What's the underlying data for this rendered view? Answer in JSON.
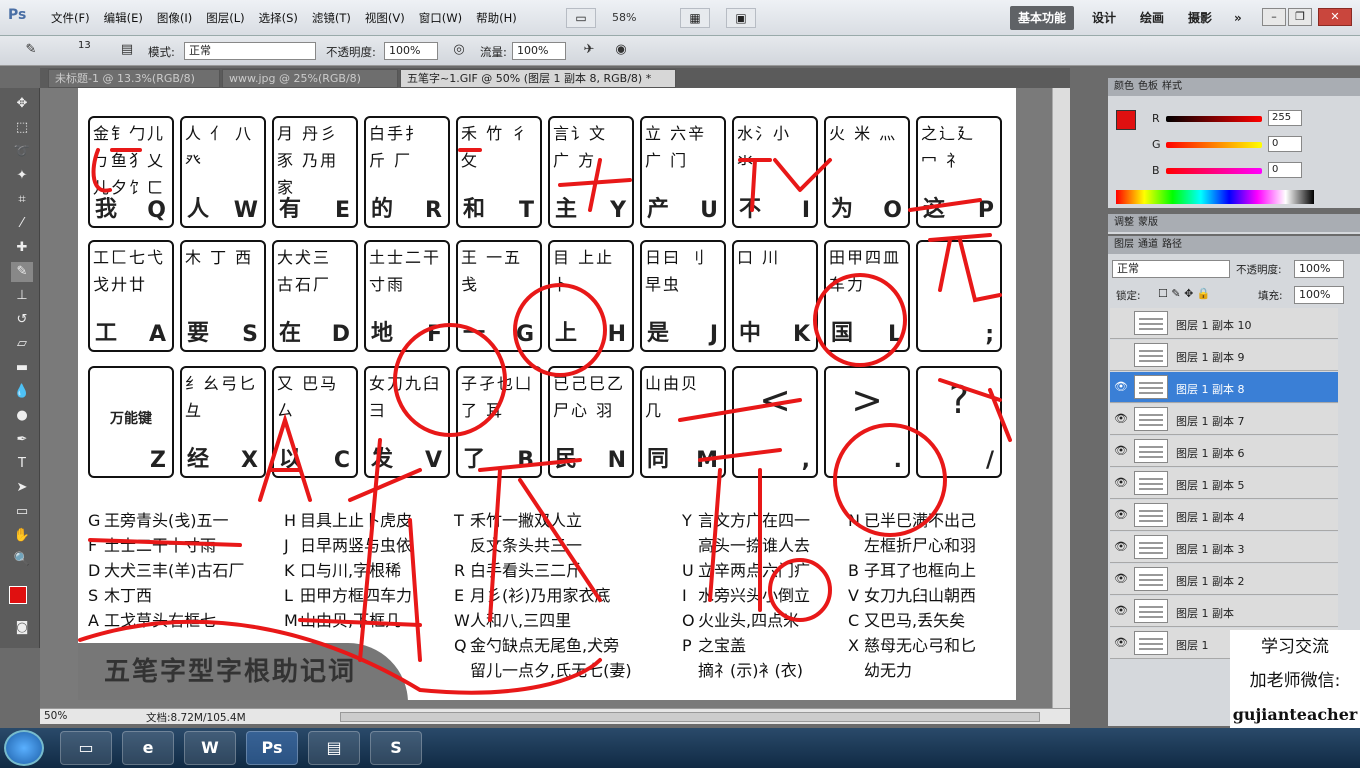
{
  "app": {
    "menus": [
      "文件(F)",
      "编辑(E)",
      "图像(I)",
      "图层(L)",
      "选择(S)",
      "滤镜(T)",
      "视图(V)",
      "窗口(W)",
      "帮助(H)"
    ],
    "zoom": "58%",
    "logo": "Ps"
  },
  "workspace": {
    "buttons": [
      "基本功能",
      "设计",
      "绘画",
      "摄影"
    ],
    "more": "»"
  },
  "options": {
    "mode_label": "模式:",
    "mode_value": "正常",
    "opacity_label": "不透明度:",
    "opacity_value": "100%",
    "flow_label": "流量:",
    "flow_value": "100%",
    "brush_size": "13"
  },
  "tabs": [
    "未标题-1 @ 13.3%(RGB/8)",
    "www.jpg @ 25%(RGB/8)",
    "五笔字~1.GIF @ 50% (图层 1 副本 8, RGB/8) *"
  ],
  "keys_row1": [
    {
      "roots": "金钅勹儿 ㄅ鱼犭乂 儿夕饣ㄈ",
      "ch": "我",
      "letter": "Q"
    },
    {
      "roots": "人 亻 八 癶",
      "ch": "人",
      "letter": "W"
    },
    {
      "roots": "月 丹彡 豕 乃用家",
      "ch": "有",
      "letter": "E"
    },
    {
      "roots": "白手扌 斤 厂",
      "ch": "的",
      "letter": "R"
    },
    {
      "roots": "禾 竹 彳 攵",
      "ch": "和",
      "letter": "T"
    },
    {
      "roots": "言讠文 广 方",
      "ch": "主",
      "letter": "Y"
    },
    {
      "roots": "立 六辛 广 门",
      "ch": "产",
      "letter": "U"
    },
    {
      "roots": "水氵小 氺",
      "ch": "不",
      "letter": "I"
    },
    {
      "roots": "火 米 灬",
      "ch": "为",
      "letter": "O"
    },
    {
      "roots": "之辶廴 冖 礻",
      "ch": "这",
      "letter": "P"
    }
  ],
  "keys_row2": [
    {
      "roots": "工匚七弋 戈廾廿",
      "ch": "工",
      "letter": "A"
    },
    {
      "roots": "木 丁 西",
      "ch": "要",
      "letter": "S"
    },
    {
      "roots": "大犬三 古石厂",
      "ch": "在",
      "letter": "D"
    },
    {
      "roots": "土士二干 寸雨",
      "ch": "地",
      "letter": "F"
    },
    {
      "roots": "王 一五 戋",
      "ch": "一",
      "letter": "G"
    },
    {
      "roots": "目 上止 卜",
      "ch": "上",
      "letter": "H"
    },
    {
      "roots": "日曰 刂 早虫",
      "ch": "是",
      "letter": "J"
    },
    {
      "roots": "口 川",
      "ch": "中",
      "letter": "K"
    },
    {
      "roots": "田甲四皿 车力",
      "ch": "国",
      "letter": "L"
    },
    {
      "roots": "",
      "ch": "",
      "letter": ";"
    }
  ],
  "keys_row3": [
    {
      "roots": "",
      "ch": "",
      "letter": "Z",
      "mid": "万能键"
    },
    {
      "roots": "纟幺弓匕 彑",
      "ch": "经",
      "letter": "X"
    },
    {
      "roots": "又 巴马 ㄙ",
      "ch": "以",
      "letter": "C"
    },
    {
      "roots": "女刀九臼 彐",
      "ch": "发",
      "letter": "V"
    },
    {
      "roots": "子孑也凵 了 耳",
      "ch": "了",
      "letter": "B"
    },
    {
      "roots": "已己巳乙 尸心 羽",
      "ch": "民",
      "letter": "N"
    },
    {
      "roots": "山由贝 几",
      "ch": "同",
      "letter": "M"
    },
    {
      "roots": "",
      "ch": "",
      "letter": ",",
      "big": "<"
    },
    {
      "roots": "",
      "ch": "",
      "letter": ".",
      "big": ">"
    },
    {
      "roots": "",
      "ch": "",
      "letter": "/",
      "big": "?"
    }
  ],
  "mnemonics": [
    {
      "k": "G",
      "t": "王旁青头(戋)五一"
    },
    {
      "k": "F",
      "t": "土士二干十寸雨"
    },
    {
      "k": "D",
      "t": "大犬三丰(羊)古石厂"
    },
    {
      "k": "S",
      "t": "木丁西"
    },
    {
      "k": "A",
      "t": "工戈草头右框七"
    },
    {
      "k": "H",
      "t": "目具上止卜虎皮"
    },
    {
      "k": "J",
      "t": "日早两竖与虫依"
    },
    {
      "k": "K",
      "t": "口与川,字根稀"
    },
    {
      "k": "L",
      "t": "田甲方框四车力"
    },
    {
      "k": "M",
      "t": "山由贝,下框几"
    },
    {
      "k": "T",
      "t": "禾竹一撇双人立"
    },
    {
      "k": "",
      "t": "反文条头共三一"
    },
    {
      "k": "R",
      "t": "白手看头三二斤"
    },
    {
      "k": "E",
      "t": "月彡(衫)乃用家衣底"
    },
    {
      "k": "W",
      "t": "人和八,三四里"
    },
    {
      "k": "Q",
      "t": "金勺缺点无尾鱼,犬旁"
    },
    {
      "k": "",
      "t": "留儿一点夕,氏无七(妻)"
    },
    {
      "k": "Y",
      "t": "言文方广在四一"
    },
    {
      "k": "",
      "t": "高头一捺谁人去"
    },
    {
      "k": "U",
      "t": "立辛两点六门疒"
    },
    {
      "k": "I",
      "t": "水旁兴头小倒立"
    },
    {
      "k": "O",
      "t": "火业头,四点米"
    },
    {
      "k": "P",
      "t": "之宝盖"
    },
    {
      "k": "",
      "t": "摘礻(示)衤(衣)"
    },
    {
      "k": "N",
      "t": "已半巳满不出己"
    },
    {
      "k": "",
      "t": "左框折尸心和羽"
    },
    {
      "k": "B",
      "t": "子耳了也框向上"
    },
    {
      "k": "V",
      "t": "女刀九臼山朝西"
    },
    {
      "k": "C",
      "t": "又巴马,丢矢矣"
    },
    {
      "k": "X",
      "t": "慈母无心弓和匕"
    },
    {
      "k": "",
      "t": "幼无力"
    }
  ],
  "doc_title": "五笔字型字根助记词",
  "status": {
    "zoom": "50%",
    "doc": "文档:8.72M/105.4M"
  },
  "color_panel": {
    "tabs": [
      "颜色",
      "色板",
      "样式"
    ],
    "r": "255",
    "g": "0",
    "b": "0",
    "r_label": "R",
    "g_label": "G",
    "b_label": "B"
  },
  "adjust_tabs": [
    "调整",
    "蒙版"
  ],
  "layers_panel": {
    "tabs": [
      "图层",
      "通道",
      "路径"
    ],
    "blend": "正常",
    "opacity_label": "不透明度:",
    "opacity": "100%",
    "lock_label": "锁定:",
    "fill_label": "填充:",
    "fill": "100%",
    "layers": [
      "图层 1 副本 10",
      "图层 1 副本 9",
      "图层 1 副本 8",
      "图层 1 副本 7",
      "图层 1 副本 6",
      "图层 1 副本 5",
      "图层 1 副本 4",
      "图层 1 副本 3",
      "图层 1 副本 2",
      "图层 1 副本",
      "图层 1"
    ],
    "selected": 2
  },
  "watermark": {
    "line1": "学习交流",
    "line2": "加老师微信:",
    "line3": "gujianteacher"
  },
  "colors": {
    "accent": "#e01010",
    "selected_layer": "#3a7fd6"
  }
}
